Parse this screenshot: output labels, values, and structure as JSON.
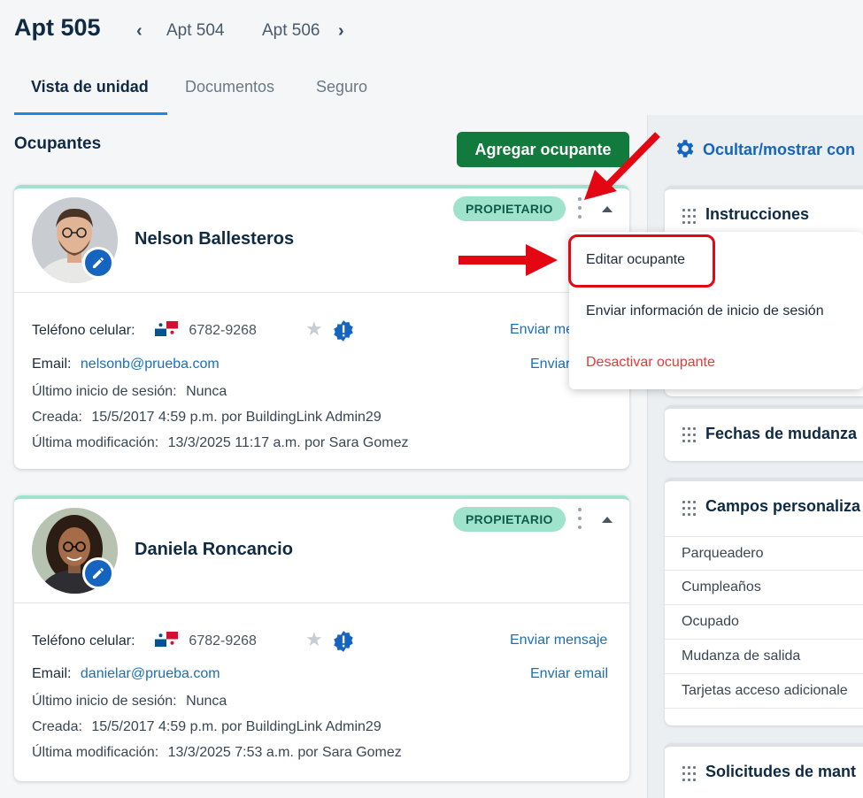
{
  "header": {
    "title": "Apt 505",
    "prev_unit": "Apt 504",
    "next_unit": "Apt 506",
    "tabs": [
      "Vista de unidad",
      "Documentos",
      "Seguro"
    ]
  },
  "occupants": {
    "title": "Ocupantes",
    "add_button": "Agregar ocupante",
    "cards": [
      {
        "name": "Nelson Ballesteros",
        "role": "PROPIETARIO",
        "phone_label": "Teléfono celular:",
        "phone": "6782-9268",
        "email_label": "Email:",
        "email": "nelsonb@prueba.com",
        "last_login_label": "Último inicio de sesión:",
        "last_login": "Nunca",
        "created_label": "Creada:",
        "created": "15/5/2017 4:59 p.m. por BuildingLink Admin29",
        "modified_label": "Última modificación:",
        "modified": "13/3/2025 11:17 a.m. por Sara Gomez",
        "send_message": "Enviar mensaje",
        "send_email": "Enviar email"
      },
      {
        "name": "Daniela Roncancio",
        "role": "PROPIETARIO",
        "phone_label": "Teléfono celular:",
        "phone": "6782-9268",
        "email_label": "Email:",
        "email": "danielar@prueba.com",
        "last_login_label": "Último inicio de sesión:",
        "last_login": "Nunca",
        "created_label": "Creada:",
        "created": "15/5/2017 4:59 p.m. por BuildingLink Admin29",
        "modified_label": "Última modificación:",
        "modified": "13/3/2025 7:53 a.m. por Sara Gomez",
        "send_message": "Enviar mensaje",
        "send_email": "Enviar email"
      }
    ]
  },
  "dropdown": {
    "items": [
      "Editar ocupante",
      "Enviar información de inicio de sesión",
      "Desactivar ocupante"
    ]
  },
  "sidebar": {
    "toggle_label": "Ocultar/mostrar con",
    "panels": {
      "instructions": "Instrucciones",
      "move_dates": "Fechas de mudanza",
      "custom_fields": "Campos personaliza",
      "maintenance": "Solicitudes de mant"
    },
    "custom_fields": [
      "Parqueadero",
      "Cumpleaños",
      "Ocupado",
      "Mudanza de salida",
      "Tarjetas acceso adicionale"
    ]
  },
  "colors": {
    "primary_green": "#127a3c",
    "role_badge": "#9fe3cd",
    "link_blue": "#1b6fb8",
    "danger_red": "#e53935",
    "annotation_red": "#e30613"
  },
  "icons": [
    "chevron-left-icon",
    "chevron-right-icon",
    "pencil-icon",
    "kebab-menu-icon",
    "caret-up-icon",
    "panama-flag-icon",
    "star-icon",
    "verified-seal-icon",
    "gear-icon",
    "drag-handle-icon",
    "red-arrow-annotation"
  ]
}
